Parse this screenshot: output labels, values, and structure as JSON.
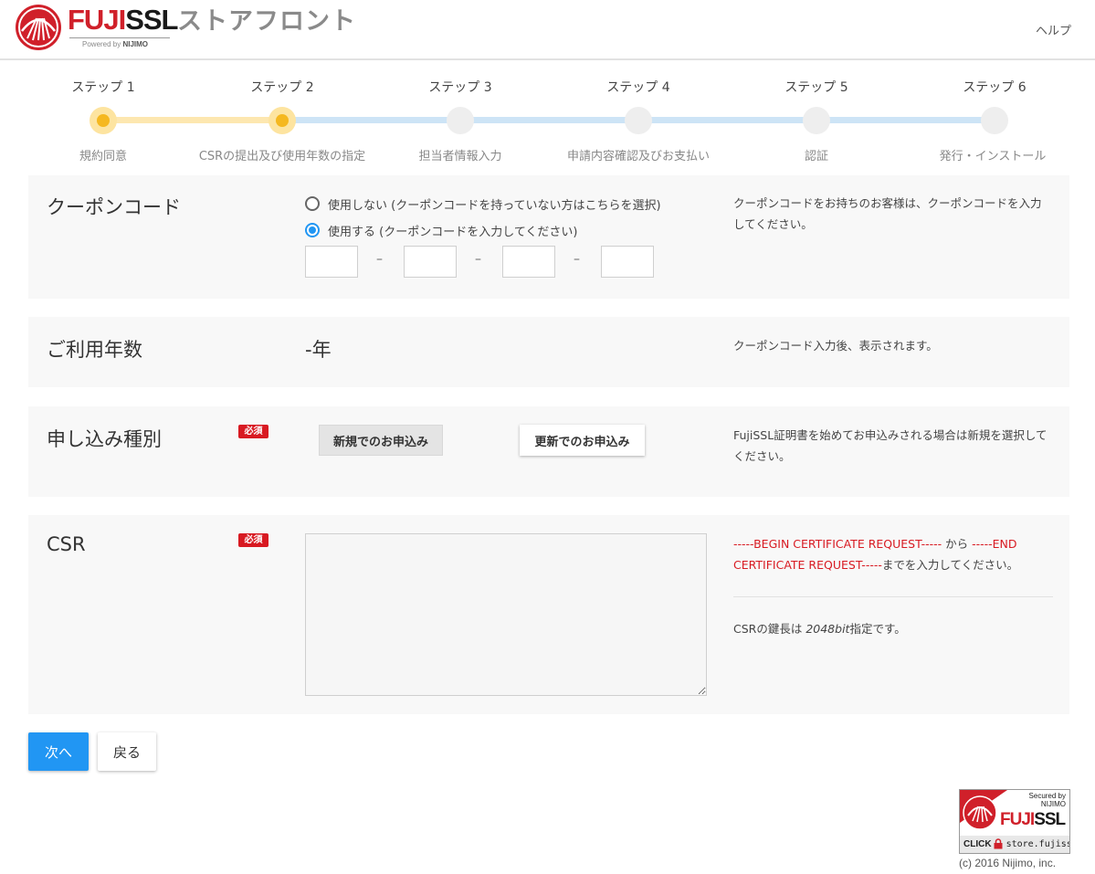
{
  "header": {
    "brand_fuji": "FUJI",
    "brand_ssl": "SSL",
    "powered_prefix": "Powered by ",
    "powered_name": "NIJIMO",
    "store_title": "ストアフロント",
    "help_label": "ヘルプ"
  },
  "stepper": {
    "current_step": 2,
    "steps": [
      {
        "label": "ステップ 1",
        "desc": "規約同意"
      },
      {
        "label": "ステップ 2",
        "desc": "CSRの提出及び使用年数の指定"
      },
      {
        "label": "ステップ 3",
        "desc": "担当者情報入力"
      },
      {
        "label": "ステップ 4",
        "desc": "申請内容確認及びお支払い"
      },
      {
        "label": "ステップ 5",
        "desc": "認証"
      },
      {
        "label": "ステップ 6",
        "desc": "発行・インストール"
      }
    ]
  },
  "coupon": {
    "title": "クーポンコード",
    "option_no": "使用しない (クーポンコードを持っていない方はこちらを選択)",
    "option_yes": "使用する (クーポンコードを入力してください)",
    "selected": "yes",
    "separator": "–",
    "inputs": [
      "",
      "",
      "",
      ""
    ],
    "help": "クーポンコードをお持ちのお客様は、クーポンコードを入力してください。"
  },
  "years": {
    "title": "ご利用年数",
    "value": "-年",
    "help": "クーポンコード入力後、表示されます。"
  },
  "apply_type": {
    "title": "申し込み種別",
    "required_badge": "必須",
    "new_label": "新規でのお申込み",
    "renew_label": "更新でのお申込み",
    "selected": "new",
    "help": "FujiSSL証明書を始めてお申込みされる場合は新規を選択してください。"
  },
  "csr": {
    "title": "CSR",
    "required_badge": "必須",
    "value": "",
    "help_begin": "-----BEGIN CERTIFICATE REQUEST-----",
    "help_from": " から ",
    "help_end": "-----END CERTIFICATE REQUEST-----",
    "help_tail": "までを入力してください。",
    "keylen_prefix": "CSRの鍵長は ",
    "keylen_value": "2048bit",
    "keylen_suffix": "指定です。"
  },
  "actions": {
    "next_label": "次へ",
    "back_label": "戻る"
  },
  "seal": {
    "top_line1": "Secured by",
    "top_line2": "NIJIMO",
    "brand_fuji": "FUJI",
    "brand_ssl": "SSL",
    "click_label": "CLICK",
    "url": "store.fujissl"
  },
  "footer": {
    "copyright": "(c) 2016 Nijimo, inc."
  },
  "colors": {
    "brand_red": "#d0202a",
    "accent_blue": "#2196f3",
    "step_done": "#f5b820",
    "required_red": "#d81a22"
  }
}
